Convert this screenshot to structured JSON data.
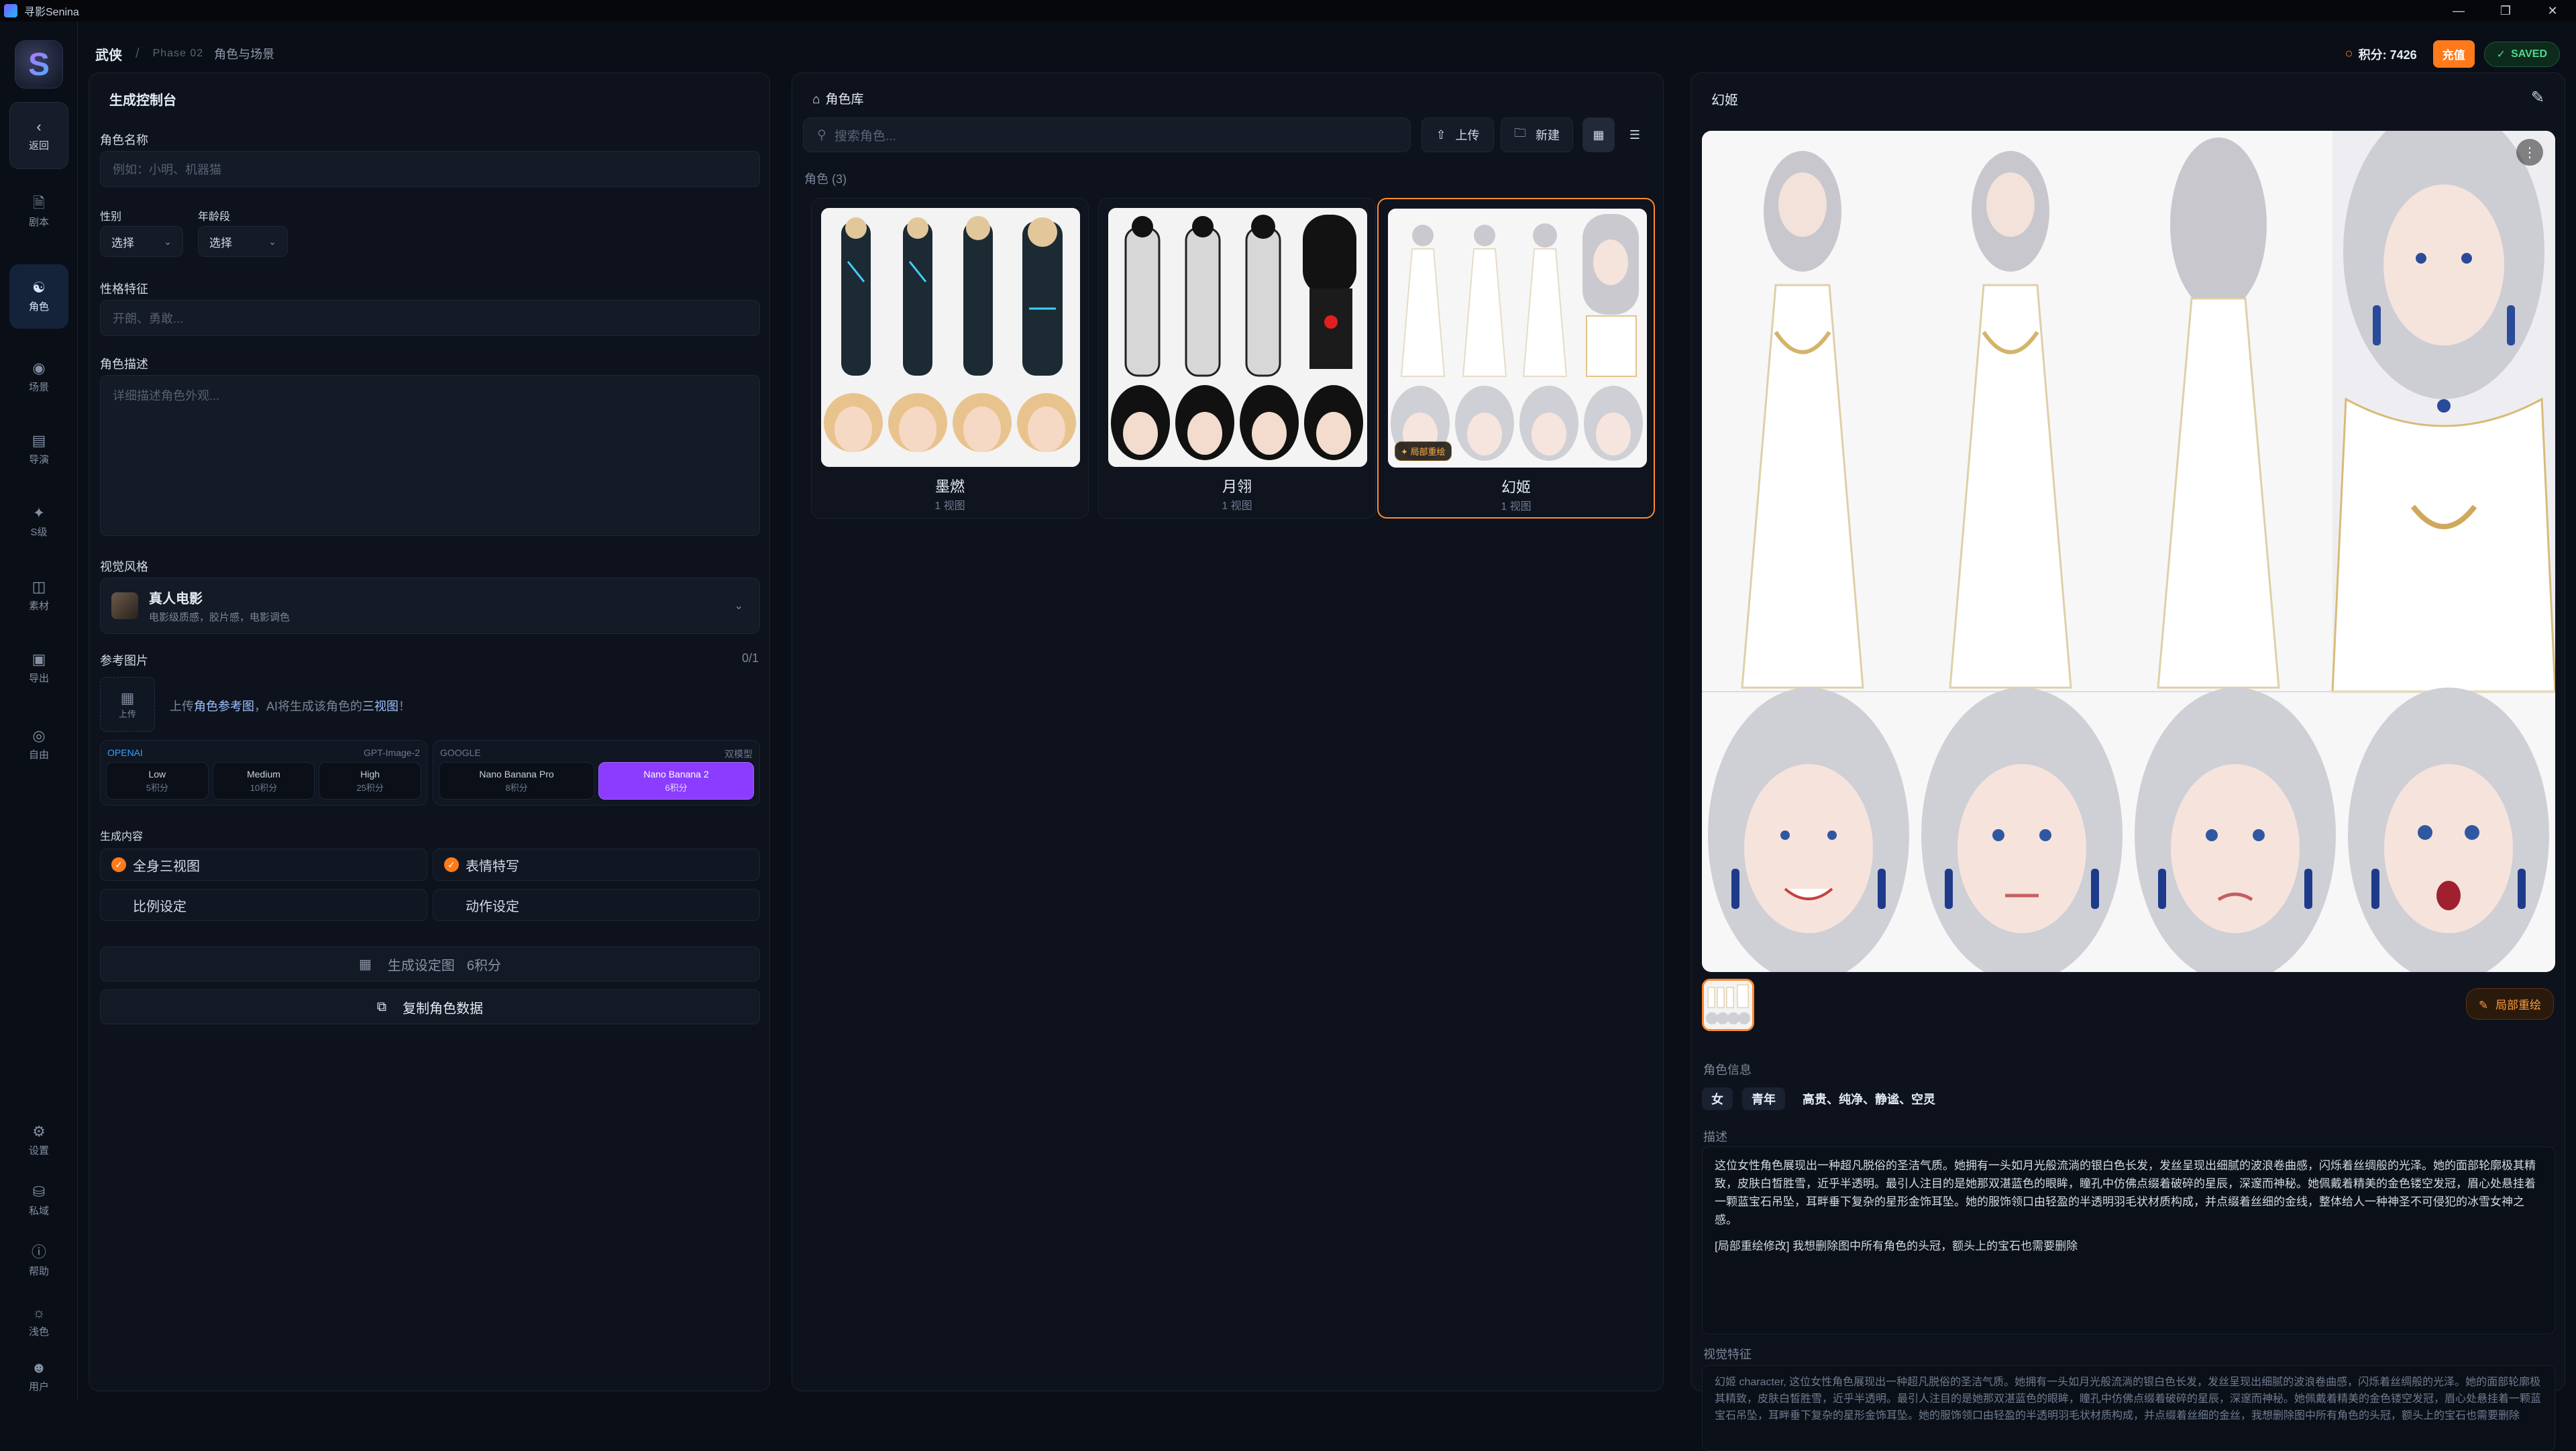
{
  "window": {
    "title": "寻影Senina"
  },
  "nav": {
    "back_label": "返回",
    "items": [
      {
        "label": "剧本",
        "icon": "document-icon"
      },
      {
        "label": "角色",
        "icon": "user-icon"
      },
      {
        "label": "场景",
        "icon": "location-pin-icon"
      },
      {
        "label": "导演",
        "icon": "clapper-icon"
      },
      {
        "label": "S级",
        "icon": "sparkle-icon"
      },
      {
        "label": "素材",
        "icon": "video-camera-icon"
      },
      {
        "label": "导出",
        "icon": "film-icon"
      },
      {
        "label": "自由",
        "icon": "palette-icon"
      }
    ],
    "bottom_items": [
      {
        "label": "设置",
        "icon": "gear-icon"
      },
      {
        "label": "私域",
        "icon": "database-icon"
      },
      {
        "label": "帮助",
        "icon": "help-circle-icon"
      },
      {
        "label": "浅色",
        "icon": "sun-icon"
      },
      {
        "label": "用户",
        "icon": "user-circle-icon"
      }
    ]
  },
  "breadcrumb": {
    "project": "武侠",
    "separator": "/",
    "phase": "Phase 02",
    "page": "角色与场景"
  },
  "header": {
    "points_label": "积分: 7426",
    "recharge_label": "充值",
    "saved_label": "SAVED"
  },
  "control_panel": {
    "title": "生成控制台",
    "name_label": "角色名称",
    "name_placeholder": "例如：小明、机器猫",
    "gender_label": "性别",
    "gender_value": "选择",
    "age_label": "年龄段",
    "age_value": "选择",
    "personality_label": "性格特征",
    "personality_placeholder": "开朗、勇敢...",
    "description_label": "角色描述",
    "description_placeholder": "详细描述角色外观...",
    "style_label": "视觉风格",
    "style_name": "真人电影",
    "style_sub": "电影级质感，胶片感，电影调色",
    "ref_label": "参考图片",
    "ref_count": "0/1",
    "upload_label": "上传",
    "upload_hint_pre": "上传",
    "upload_hint_link": "角色参考图",
    "upload_hint_mid": "，AI将生成该角色的",
    "upload_hint_link2": "三视图",
    "upload_hint_end": "！",
    "openai": {
      "provider": "OPENAI",
      "model": "GPT-Image-2",
      "options": [
        {
          "name": "Low",
          "pts": "5积分"
        },
        {
          "name": "Medium",
          "pts": "10积分"
        },
        {
          "name": "High",
          "pts": "25积分"
        }
      ]
    },
    "google": {
      "provider": "GOOGLE",
      "model": "双模型",
      "options": [
        {
          "name": "Nano Banana Pro",
          "pts": "8积分"
        },
        {
          "name": "Nano Banana 2",
          "pts": "6积分"
        }
      ]
    },
    "gen_label": "生成内容",
    "gen_items": [
      "全身三视图",
      "表情特写",
      "比例设定",
      "动作设定"
    ],
    "generate_button": "生成设定图",
    "generate_cost": "6积分",
    "copy_button": "复制角色数据"
  },
  "library": {
    "title": "角色库",
    "search_placeholder": "搜索角色...",
    "upload_label": "上传",
    "new_label": "新建",
    "count_label": "角色 (3)",
    "characters": [
      {
        "name": "墨燃",
        "views": "1 视图"
      },
      {
        "name": "月翎",
        "views": "1 视图"
      },
      {
        "name": "幻姬",
        "views": "1 视图",
        "badge": "局部重绘"
      }
    ]
  },
  "detail": {
    "title": "幻姬",
    "local_redraw_label": "局部重绘",
    "info_label": "角色信息",
    "tags": [
      "女",
      "青年",
      "高贵、纯净、静谧、空灵"
    ],
    "desc_label": "描述",
    "description": "这位女性角色展现出一种超凡脱俗的圣洁气质。她拥有一头如月光般流淌的银白色长发，发丝呈现出细腻的波浪卷曲感，闪烁着丝绸般的光泽。她的面部轮廓极其精致，皮肤白皙胜雪，近乎半透明。最引人注目的是她那双湛蓝色的眼眸，瞳孔中仿佛点缀着破碎的星辰，深邃而神秘。她佩戴着精美的金色镂空发冠，眉心处悬挂着一颗蓝宝石吊坠，耳畔垂下复杂的星形金饰耳坠。她的服饰领口由轻盈的半透明羽毛状材质构成，并点缀着丝细的金线，整体给人一种神圣不可侵犯的冰雪女神之感。",
    "description_note": "[局部重绘修改] 我想删除图中所有角色的头冠，额头上的宝石也需要删除",
    "visual_label": "视觉特征",
    "visual": "幻姬 character, 这位女性角色展现出一种超凡脱俗的圣洁气质。她拥有一头如月光般流淌的银白色长发，发丝呈现出细腻的波浪卷曲感，闪烁着丝绸般的光泽。她的面部轮廓极其精致，皮肤白皙胜雪，近乎半透明。最引人注目的是她那双湛蓝色的眼眸，瞳孔中仿佛点缀着破碎的星辰，深邃而神秘。她佩戴着精美的金色镂空发冠，眉心处悬挂着一颗蓝宝石吊坠，耳畔垂下复杂的星形金饰耳坠。她的服饰领口由轻盈的半透明羽毛状材质构成，并点缀着丝细的金丝，我想删除图中所有角色的头冠，额头上的宝石也需要删除"
  }
}
